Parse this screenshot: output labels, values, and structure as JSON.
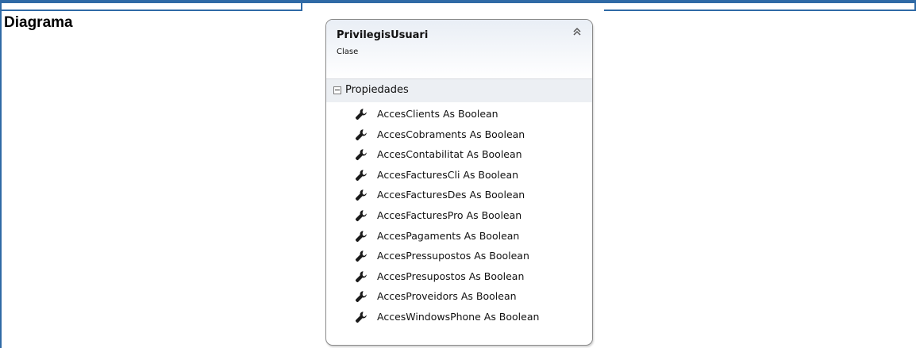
{
  "section": {
    "label": "Diagrama"
  },
  "class_shape": {
    "name": "PrivilegisUsuari",
    "kind": "Clase",
    "compartment": "Propiedades",
    "properties": [
      "AccesClients As Boolean",
      "AccesCobraments As Boolean",
      "AccesContabilitat As Boolean",
      "AccesFacturesCli As Boolean",
      "AccesFacturesDes As Boolean",
      "AccesFacturesPro As Boolean",
      "AccesPagaments As Boolean",
      "AccesPressupostos As Boolean",
      "AccesPresupostos As Boolean",
      "AccesProveidors As Boolean",
      "AccesWindowsPhone As Boolean"
    ]
  },
  "icons": {
    "collapse": "double-chevron-up-icon",
    "compartment_toggle": "minus-box-icon",
    "property": "wrench-icon"
  },
  "colors": {
    "table_border": "#2f6aa6",
    "shape_border": "#8a8a8a",
    "compartment_bg": "#eceff3"
  }
}
